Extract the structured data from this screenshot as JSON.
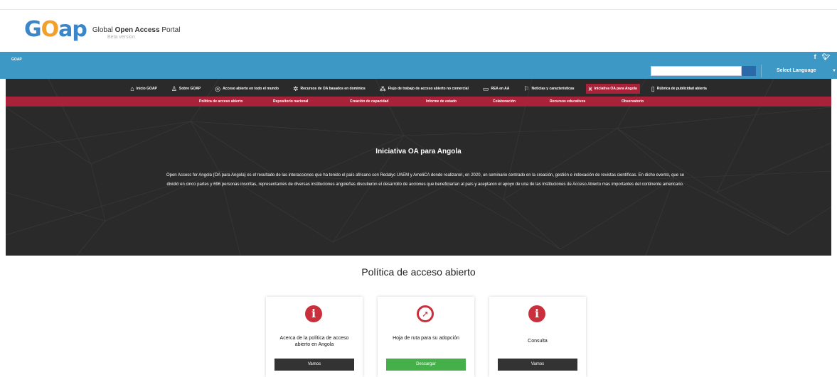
{
  "logo": {
    "mark": "GOAP",
    "brand_regular": "Global ",
    "brand_bold": "Open Access",
    "brand_end": " Portal",
    "beta": "Beta version"
  },
  "topbar": {
    "site_label": "GOAP",
    "social": [
      "f",
      "t"
    ],
    "language_label": "Select Language",
    "search_placeholder": ""
  },
  "mainnav": [
    {
      "icon": "home-icon",
      "glyph": "⌂",
      "label": "Inicio GOAP"
    },
    {
      "icon": "user-icon",
      "glyph": "♙",
      "label": "Sobre GOAP"
    },
    {
      "icon": "globe-icon",
      "glyph": "◎",
      "label": "Acceso abierto en todo el mundo"
    },
    {
      "icon": "star-icon",
      "glyph": "✲",
      "label": "Recursos de OA basados en dominios"
    },
    {
      "icon": "flow-icon",
      "glyph": "⁂",
      "label": "Flujo de trabajo de acceso abierto no comercial"
    },
    {
      "icon": "rea-icon",
      "glyph": "▭",
      "label": "REA en AA"
    },
    {
      "icon": "news-icon",
      "glyph": "⚐",
      "label": "Noticias y características"
    },
    {
      "icon": "mountain-icon",
      "glyph": "⩙",
      "label": "Iniciativa OA para Angola",
      "active": true
    },
    {
      "icon": "document-icon",
      "glyph": "▯",
      "label": "Rúbrica de publicidad abierta"
    }
  ],
  "subnav": [
    "Política de acceso abierto",
    "Repositorio nacional",
    "Creación de capacidad",
    "Informe de estado",
    "Colaboración",
    "Recursos educativos",
    "Observatorio"
  ],
  "hero": {
    "title": "Iniciativa OA para Angola",
    "description": "Open Access for Angola (OA para Angola) es el resultado de las interacciones que ha tenido el país africano con Redalyc UAEM y AmeliCA donde realizaron, en 2020, un seminario centrado en la creación, gestión e indexación de revistas científicas. En dicho evento, que se dividió en cinco partes y 696 personas inscritas, representantes de diversas instituciones angoleñas discutieron el desarrollo de acciones que beneficiarían al país y aceptaron el apoyo de una de las instituciones de Acceso Abierto más importantes del continente americano."
  },
  "section": {
    "title": "Política de acceso abierto",
    "cards": [
      {
        "icon": "info-icon",
        "label": "Acerca de la política de acceso abierto en Angola",
        "button": "Vamos",
        "button_color": "#333333"
      },
      {
        "icon": "compass-icon",
        "label": "Hoja de ruta para su adopción",
        "button": "Descargar",
        "button_color": "#45b04a"
      },
      {
        "icon": "info-icon",
        "label": "Consulta",
        "button": "Vamos",
        "button_color": "#333333"
      }
    ]
  },
  "colors": {
    "blue_bar": "#3d98c6",
    "accent_red": "#a8233a",
    "hero_bg": "#2a2a2a",
    "green": "#45b04a"
  }
}
